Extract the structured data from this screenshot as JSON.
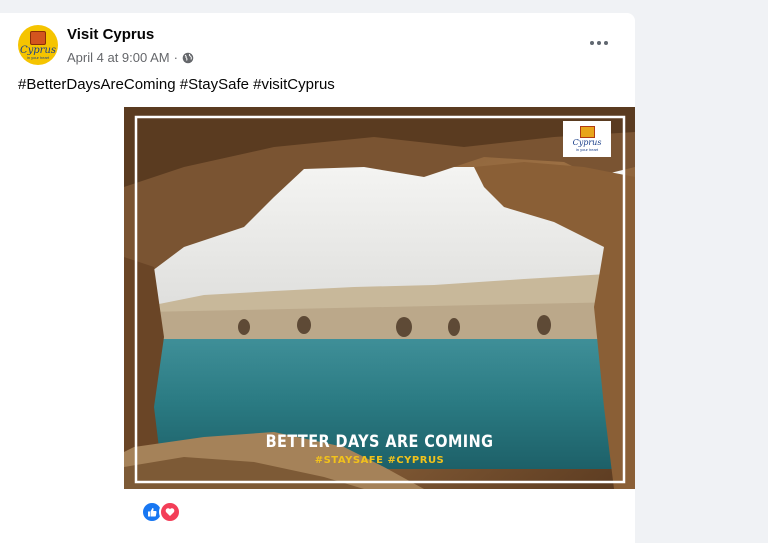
{
  "post": {
    "author": "Visit Cyprus",
    "timestamp": "April 4 at 9:00 AM",
    "separator": "·",
    "privacy_icon": "globe-icon",
    "more_icon": "more-options-icon",
    "caption": "#BetterDaysAreComing #StaySafe #visitCyprus",
    "avatar_logo": {
      "text": "Cyprus",
      "subtext": "in your heart"
    },
    "image": {
      "alt": "Sea cave arch framing turquoise bay and cliffs",
      "badge_logo": {
        "text": "Cyprus",
        "subtext": "in your heart"
      },
      "headline": "BETTER DAYS ARE COMING",
      "tagline": "#STAYSAFE #CYPRUS"
    },
    "reactions": [
      "like-icon",
      "love-icon"
    ]
  },
  "colors": {
    "page_bg": "#f0f2f5",
    "card_bg": "#ffffff",
    "text_primary": "#050505",
    "text_secondary": "#65676b",
    "like_blue": "#1877f2",
    "love_red": "#f33e58",
    "tag_yellow": "#f2c21b"
  }
}
